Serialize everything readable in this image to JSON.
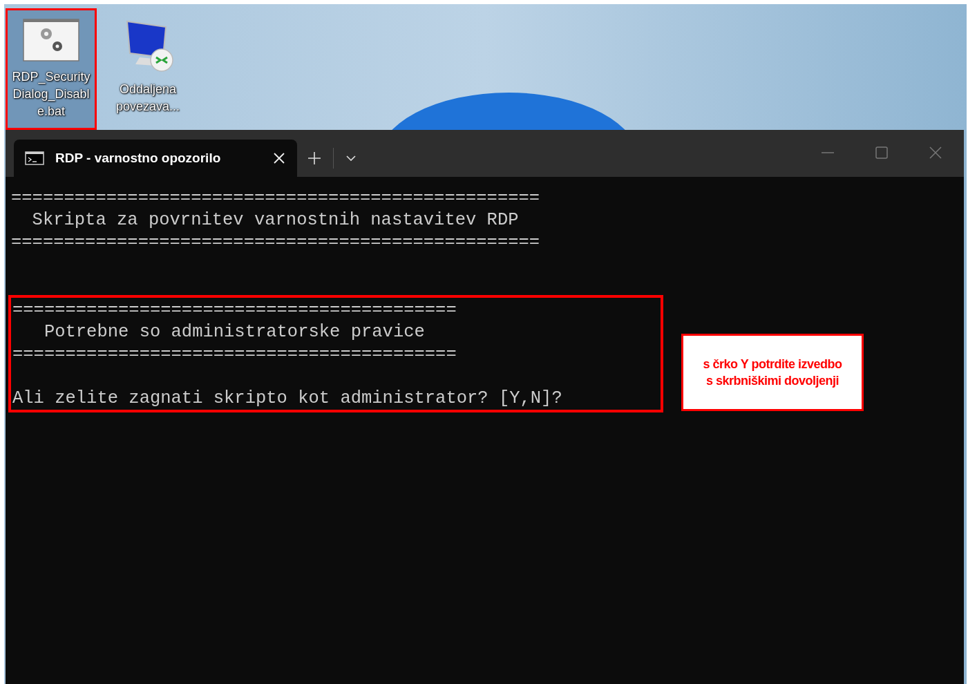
{
  "desktop_icons": [
    {
      "kind": "script",
      "label": "RDP_Security Dialog_Disabl e.bat",
      "selected": true,
      "highlighted": true
    },
    {
      "kind": "remote",
      "label": "Oddaljena povezava...",
      "selected": false,
      "highlighted": false
    }
  ],
  "window": {
    "tab": {
      "title": "RDP - varnostno opozorilo",
      "selected": true
    },
    "blocks": [
      {
        "highlighted": false,
        "lines": [
          {
            "kind": "text",
            "text": "=================================================="
          },
          {
            "kind": "text",
            "text": "  Skripta za povrnitev varnostnih nastavitev RDP"
          },
          {
            "kind": "text",
            "text": "=================================================="
          },
          {
            "kind": "blank"
          },
          {
            "kind": "blank"
          }
        ]
      },
      {
        "highlighted": true,
        "lines": [
          {
            "kind": "text",
            "text": "=========================================="
          },
          {
            "kind": "text",
            "text": "   Potrebne so administratorske pravice"
          },
          {
            "kind": "text",
            "text": "=========================================="
          },
          {
            "kind": "blank"
          },
          {
            "kind": "text",
            "text": "Ali zelite zagnati skripto kot administrator? [Y,N]?"
          }
        ]
      }
    ]
  },
  "callout": {
    "lines": [
      "s črko Y potrdite izvedbo",
      "s skrbniškimi dovoljenji"
    ]
  }
}
